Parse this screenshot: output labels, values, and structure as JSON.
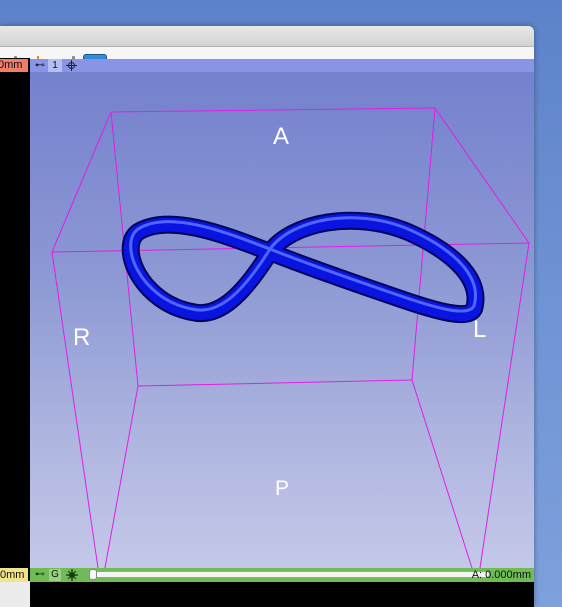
{
  "toolbar": {
    "cut_text": "n",
    "crosshair_icon": "crosshair-icon",
    "extension_icon": "extension-icon"
  },
  "left_view": {
    "top_offset_label": "0mm",
    "bottom_offset_label": "0mm"
  },
  "view_3d": {
    "view_number": "1",
    "pin_symbol": "⊷",
    "orientation": {
      "anterior": "A",
      "right": "R",
      "left": "L",
      "posterior": "P"
    },
    "colors": {
      "background_top": "#7481cd",
      "background_bottom": "#c4c8e9",
      "bounding_box": "#e01ee6",
      "curve": "#0a14e0"
    }
  },
  "slice_controller": {
    "pin_symbol": "⊷",
    "link_label": "G",
    "offset_value": "A: 0.000mm",
    "slider_position": 0,
    "bar_color": "#6fbb55"
  }
}
